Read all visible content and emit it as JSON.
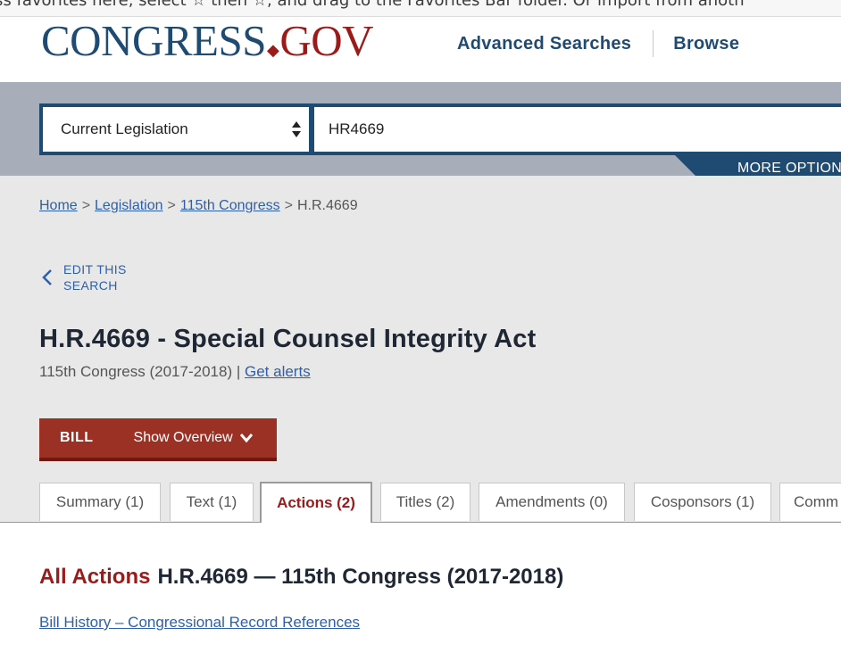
{
  "browser": {
    "favorites_hint": "ss favorites here, select ☆ then ☆, and drag to the Favorites Bar folder. Or import from anoth"
  },
  "header": {
    "logo_part1": "CONGRESS",
    "logo_dot": "◆",
    "logo_part2": "GOV",
    "nav": [
      "Advanced Searches",
      "Browse"
    ]
  },
  "search": {
    "scope_selected": "Current Legislation",
    "query_value": "HR4669",
    "more_options_label": "MORE OPTIONS"
  },
  "breadcrumb": {
    "items": [
      "Home",
      "Legislation",
      "115th Congress"
    ],
    "current": "H.R.4669",
    "separator": ">"
  },
  "edit_search": {
    "label": "EDIT THIS SEARCH"
  },
  "bill": {
    "title": "H.R.4669 - Special Counsel Integrity Act",
    "congress": "115th Congress (2017-2018)",
    "divider": "|",
    "alerts_label": "Get alerts",
    "type_label": "BILL",
    "overview_label": "Show Overview"
  },
  "tabs": [
    {
      "label": "Summary (1)",
      "active": false
    },
    {
      "label": "Text (1)",
      "active": false
    },
    {
      "label": "Actions (2)",
      "active": true
    },
    {
      "label": "Titles (2)",
      "active": false
    },
    {
      "label": "Amendments (0)",
      "active": false
    },
    {
      "label": "Cosponsors (1)",
      "active": false
    },
    {
      "label": "Comm",
      "active": false
    }
  ],
  "actions": {
    "heading_red": "All Actions",
    "heading_rest": "H.R.4669 — 115th Congress (2017-2018)",
    "history_link": "Bill History – Congressional Record References"
  },
  "colors": {
    "brand_blue": "#1f4a71",
    "brand_red": "#9b1b1b",
    "link_blue": "#2f5fa8",
    "bill_bar": "#9b3124"
  }
}
